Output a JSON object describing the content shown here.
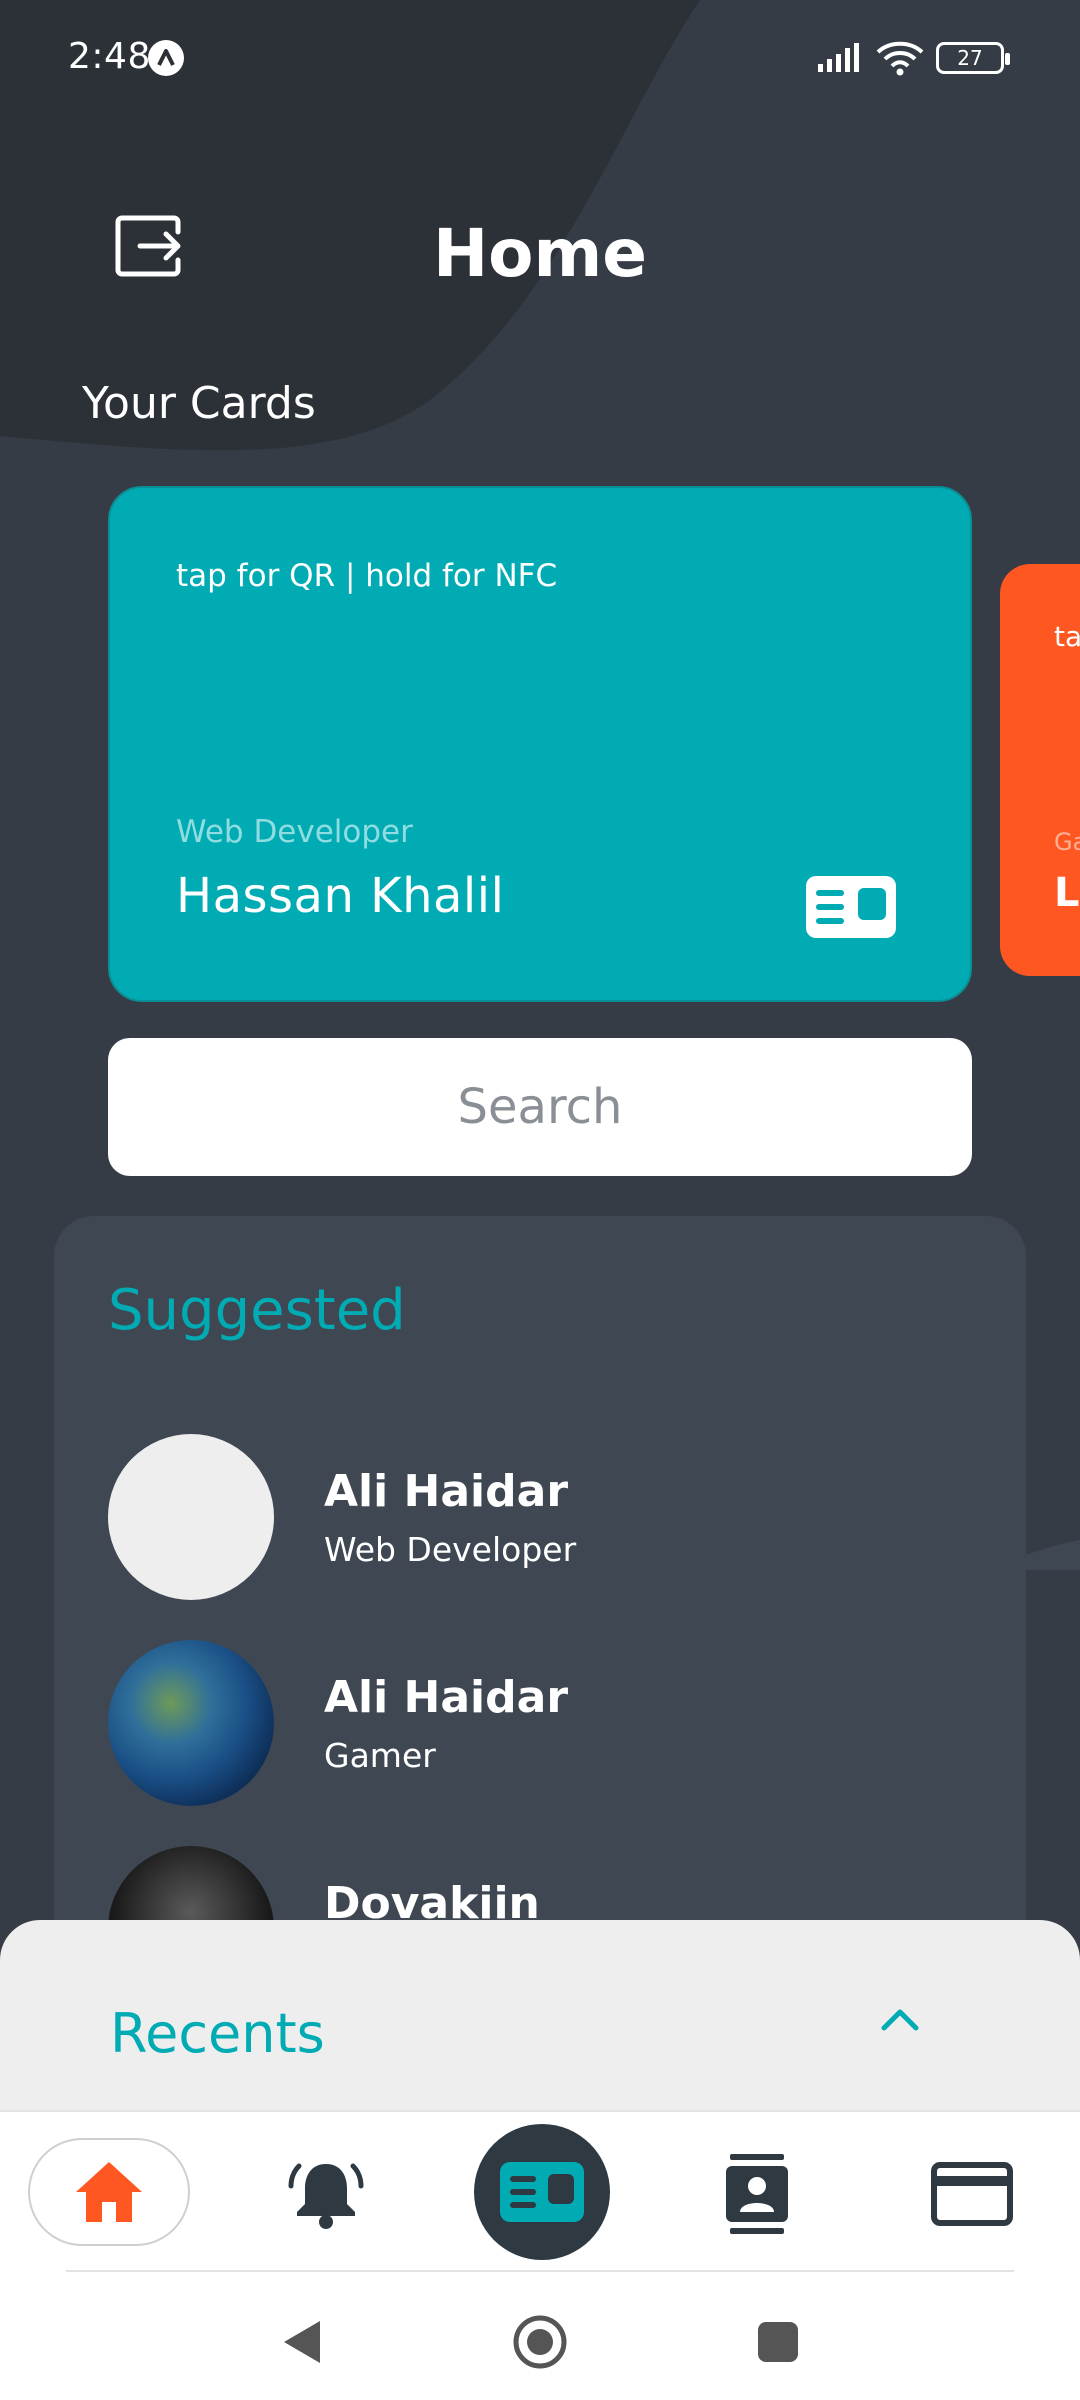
{
  "status_bar": {
    "time": "2:48",
    "battery": "27"
  },
  "header": {
    "title": "Home",
    "logout_icon": "logout-icon"
  },
  "cards_section": {
    "title": "Your Cards",
    "main_card": {
      "hint": "tap for QR | hold for NFC",
      "role": "Web Developer",
      "name": "Hassan Khalil",
      "color": "#00abb3"
    },
    "peek_card": {
      "hint": "ta",
      "role": "Ga",
      "name": "Lo",
      "color": "#ff5722"
    }
  },
  "search": {
    "placeholder": "Search"
  },
  "suggested": {
    "title": "Suggested",
    "contacts": [
      {
        "name": "Ali Haidar",
        "role": "Web Developer"
      },
      {
        "name": "Ali Haidar",
        "role": "Gamer"
      },
      {
        "name": "Dovakiin",
        "role": ""
      }
    ]
  },
  "recents": {
    "title": "Recents"
  },
  "bottom_nav": {
    "items": [
      "home-icon",
      "bell-icon",
      "id-card-icon",
      "contacts-icon",
      "credit-card-icon"
    ],
    "active": "home-icon",
    "accent": "#ff5722"
  },
  "colors": {
    "background": "#363c45",
    "accent": "#00abb3",
    "panel": "#3f4852"
  }
}
